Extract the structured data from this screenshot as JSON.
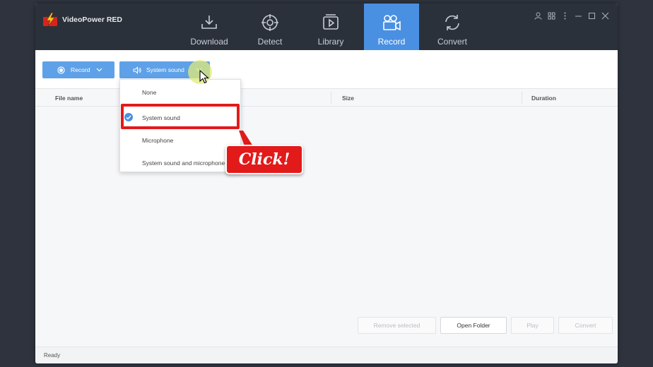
{
  "app": {
    "title": "VideoPower RED"
  },
  "nav": {
    "tabs": [
      {
        "label": "Download",
        "icon": "download-icon"
      },
      {
        "label": "Detect",
        "icon": "crosshair-icon"
      },
      {
        "label": "Library",
        "icon": "library-play-icon"
      },
      {
        "label": "Record",
        "icon": "video-camera-icon",
        "active": true
      },
      {
        "label": "Convert",
        "icon": "convert-icon"
      }
    ]
  },
  "toolbar": {
    "record_label": "Record",
    "audio_label": "System sound"
  },
  "table": {
    "columns": [
      "File name",
      "Size",
      "Duration"
    ]
  },
  "audio_menu": {
    "items": [
      {
        "label": "None",
        "checked": false
      },
      {
        "label": "System sound",
        "checked": true
      },
      {
        "label": "Microphone",
        "checked": false
      },
      {
        "label": "System sound and microphone",
        "checked": false
      }
    ]
  },
  "actions": {
    "remove_selected": "Remove selected",
    "open_folder": "Open Folder",
    "play": "Play",
    "convert": "Convert"
  },
  "status": {
    "text": "Ready"
  },
  "annotation": {
    "callout_text": "Click!"
  },
  "colors": {
    "titlebar": "#2b313b",
    "accent": "#4a90e2",
    "button": "#5ea1e8",
    "highlight": "#e21a1a"
  }
}
